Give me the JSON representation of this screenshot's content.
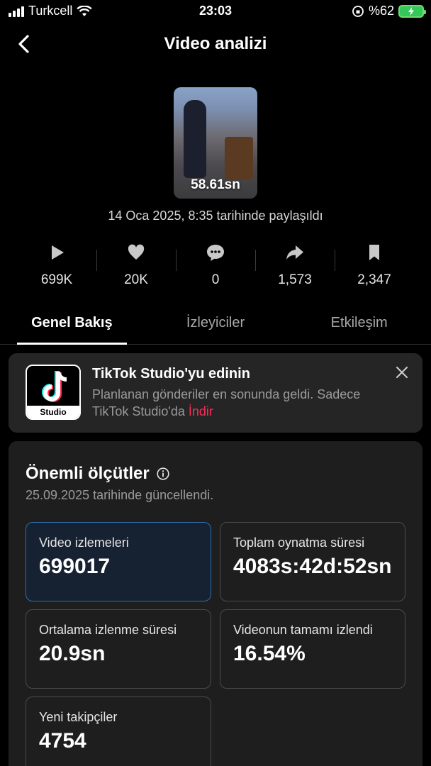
{
  "status_bar": {
    "carrier": "Turkcell",
    "time": "23:03",
    "battery": "%62"
  },
  "header": {
    "title": "Video analizi"
  },
  "video": {
    "duration": "58.61sn",
    "posted": "14 Oca 2025, 8:35 tarihinde paylaşıldı"
  },
  "stats": [
    {
      "icon": "play-icon",
      "value": "699K"
    },
    {
      "icon": "heart-icon",
      "value": "20K"
    },
    {
      "icon": "comment-icon",
      "value": "0"
    },
    {
      "icon": "share-icon",
      "value": "1,573"
    },
    {
      "icon": "bookmark-icon",
      "value": "2,347"
    }
  ],
  "tabs": [
    {
      "label": "Genel Bakış",
      "active": true
    },
    {
      "label": "İzleyiciler",
      "active": false
    },
    {
      "label": "Etkileşim",
      "active": false
    }
  ],
  "promo": {
    "logo_text": "Studio",
    "title": "TikTok Studio'yu edinin",
    "desc": "Planlanan gönderiler en sonunda geldi. Sadece TikTok Studio'da",
    "link": "İndir",
    "link_color": "#fe2c55"
  },
  "metrics": {
    "title": "Önemli ölçütler",
    "updated": "25.09.2025 tarihinde güncellendi.",
    "items": [
      {
        "label": "Video izlemeleri",
        "value": "699017"
      },
      {
        "label": "Toplam oynatma süresi",
        "value": "4083s:42d:52sn"
      },
      {
        "label": "Ortalama izlenme süresi",
        "value": "20.9sn"
      },
      {
        "label": "Videonun tamamı izlendi",
        "value": "16.54%"
      },
      {
        "label": "Yeni takipçiler",
        "value": "4754"
      }
    ]
  }
}
